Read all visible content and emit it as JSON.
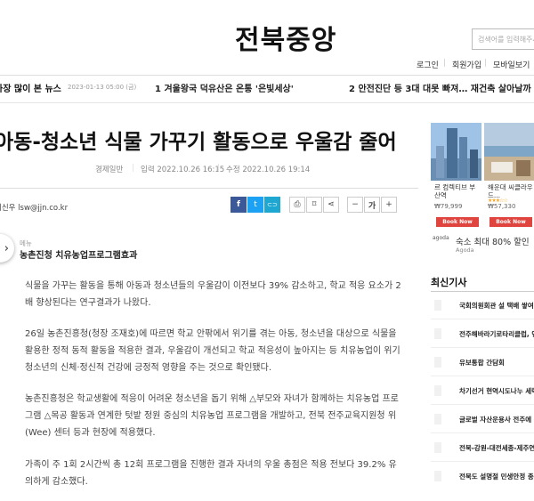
{
  "header": {
    "logo": "전북중앙",
    "search_placeholder": "검색어를 입력해주세요"
  },
  "topnav": {
    "login": "로그인",
    "signup": "회원가입",
    "mobile": "모바일보기"
  },
  "ticker": {
    "label": "가장 많이 본 뉴스",
    "date": "2023-01-13 05:00 (금)",
    "headline1": "1  겨울왕국 덕유산은 온통 '은빛세상'",
    "headline2": "2  안전진단 등 3대 대못 빠져… 재건축 살아날까"
  },
  "article": {
    "title": "아동-청소년 식물 가꾸기 활동으로 우울감 줄어",
    "category": "경제일반",
    "published": "입력 2022.10.26 16:15",
    "modified": "수정 2022.10.26 19:14",
    "byline": "이신우 lsw@jjn.co.kr",
    "menu_label": "메뉴",
    "subheading": "농촌진청 치유농업프로그램효과",
    "paragraphs": [
      "식물을 가꾸는 활동을 통해 아동과 청소년들의 우울감이 이전보다 39% 감소하고, 학교 적응 요소가 2배 향상된다는 연구결과가 나왔다.",
      "26일 농촌진흥청(청장 조재호)에 따르면 학교 안팎에서 위기를 겪는 아동, 청소년을 대상으로 식물을 활용한 정적 동적 활동을 적용한 결과, 우울감이 개선되고 학교 적응성이 높아지는 등 치유농업이 위기 청소년의 신체·정신적 건강에 긍정적 영향을 주는 것으로 확인됐다.",
      "농촌진흥청은 학교생활에 적응이 어려운 청소년을 돕기 위해 △부모와 자녀가 함께하는 치유농업 프로그램 △목공 활동과 연계한 텃밭 정원 중심의 치유농업 프로그램을 개발하고, 전북 전주교육지원청 위(Wee) 센터 등과 현장에 적용했다.",
      "가족이 주 1회 2시간씩 총 12회 프로그램을 진행한 결과 자녀의 우울 총점은 적용 전보다 39.2% 유의하게 감소했다."
    ]
  },
  "tools": {
    "facebook": "f",
    "twitter": "t",
    "link": "⊂⊃",
    "print": "⎙",
    "bookmark": "⌑",
    "share": "⋖",
    "minus": "−",
    "font": "가",
    "plus": "+"
  },
  "ad": {
    "hotel1_name": "르 컴렉티브 부산역",
    "hotel1_price": "₩79,999",
    "hotel2_name": "해운대 씨클라우드...",
    "hotel2_price": "₩57,330",
    "stars": "★★★☆☆",
    "book_label": "Book Now",
    "agoda_logo": "agoda",
    "promo": "숙소 최대 80% 할인",
    "promo_sub": "Agoda"
  },
  "sidebar": {
    "title": "최신기사",
    "items": [
      "국회의원회관 설 택배 쌓여",
      "전주해바라기로타리클럽, 연",
      "유보통합 간담회",
      "차기선거 현역시도나누 세력",
      "글로벌 자산운용사 전주에 둥",
      "전북-강원-대전세종-제주연",
      "전북도 설명절 민생안정 종합"
    ]
  },
  "colors": {
    "facebook": "#3b5998",
    "twitter": "#1da1f2",
    "book_button": "#e0443e"
  }
}
